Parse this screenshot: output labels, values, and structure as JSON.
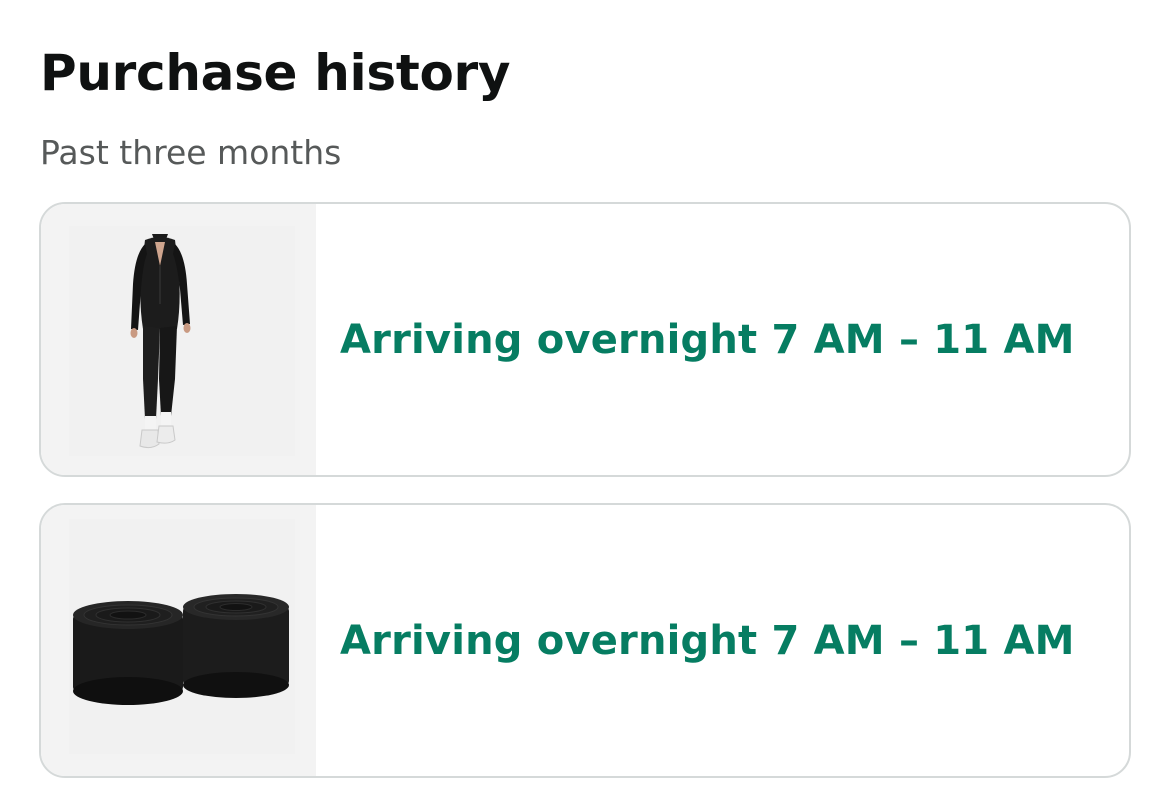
{
  "header": {
    "title": "Purchase history",
    "subtitle": "Past three months"
  },
  "orders": [
    {
      "image_icon": "product-jumpsuit-image",
      "status": "Arriving overnight 7 AM – 11 AM"
    },
    {
      "image_icon": "product-fastener-tape-rolls-image",
      "status": "Arriving overnight 7 AM – 11 AM"
    }
  ],
  "colors": {
    "title": "#0f1111",
    "subtitle": "#565959",
    "status": "#067d62",
    "card_border": "#d5d9d9",
    "thumb_background": "#f3f3f3"
  }
}
